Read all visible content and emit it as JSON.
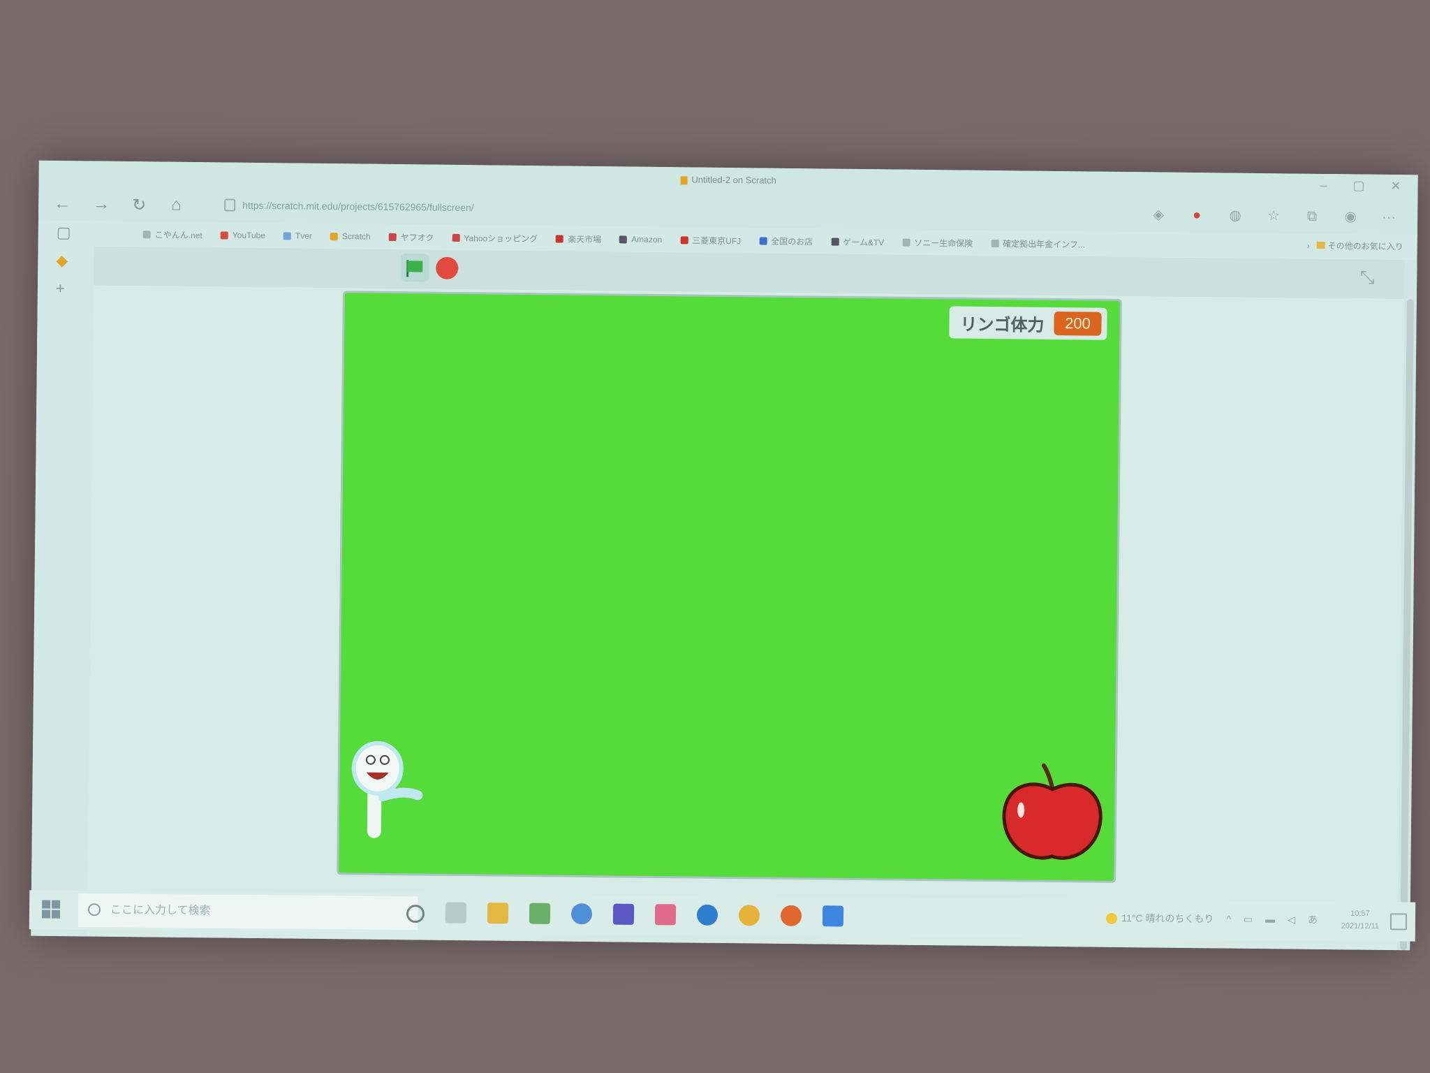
{
  "window": {
    "title": "Untitled-2 on Scratch",
    "controls": [
      "–",
      "▢",
      "✕"
    ]
  },
  "browser": {
    "url": "https://scratch.mit.edu/projects/615762965/fullscreen/",
    "nav_icons": [
      "back-icon",
      "forward-icon",
      "refresh-icon",
      "home-icon"
    ],
    "more_label": "···"
  },
  "bookmarks": [
    {
      "label": "こやんん.net",
      "color": "#9fb6b3"
    },
    {
      "label": "YouTube",
      "color": "#d84b3e"
    },
    {
      "label": "Tver",
      "color": "#6fa5d8"
    },
    {
      "label": "Scratch",
      "color": "#e3a526"
    },
    {
      "label": "ヤフオク",
      "color": "#c44"
    },
    {
      "label": "Yahooショッピング",
      "color": "#c44"
    },
    {
      "label": "楽天市場",
      "color": "#c33"
    },
    {
      "label": "Amazon",
      "color": "#556"
    },
    {
      "label": "三菱東京UFJ",
      "color": "#c33"
    },
    {
      "label": "全国のお店",
      "color": "#3b6fd0"
    },
    {
      "label": "ゲーム&TV",
      "color": "#556"
    },
    {
      "label": "ソニー生命保険",
      "color": "#9fb6b3"
    },
    {
      "label": "確定拠出年金インフ...",
      "color": "#9fb6b3"
    }
  ],
  "bookmarks_overflow": "›",
  "other_favorites": "その他のお気に入り",
  "scratch": {
    "variable_monitor": {
      "label": "リンゴ体力",
      "value": "200"
    },
    "sprites": [
      "worm-sprite",
      "apple-sprite"
    ]
  },
  "taskbar": {
    "search_placeholder": "ここに入力して検索",
    "weather": "11°C 晴れのちくもり",
    "ime": "あ",
    "time": "10:57",
    "date": "2021/12/11"
  }
}
